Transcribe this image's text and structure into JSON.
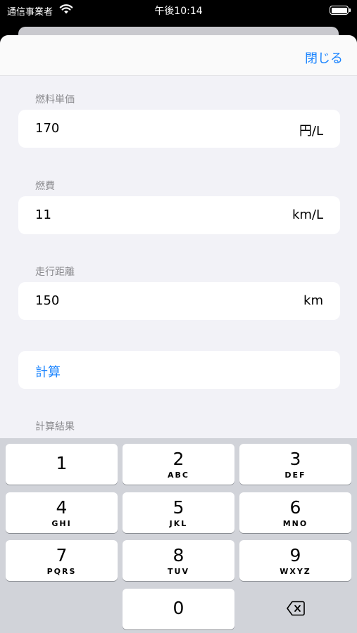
{
  "status_bar": {
    "carrier": "通信事業者",
    "time": "午後10:14"
  },
  "header": {
    "close_label": "閉じる"
  },
  "fields": [
    {
      "label": "燃料単価",
      "value": "170",
      "unit": "円/L"
    },
    {
      "label": "燃費",
      "value": "11",
      "unit": "km/L"
    },
    {
      "label": "走行距離",
      "value": "150",
      "unit": "km"
    }
  ],
  "calc_button": {
    "label": "計算"
  },
  "result": {
    "label": "計算結果"
  },
  "keypad": {
    "keys": [
      {
        "num": "1",
        "letters": ""
      },
      {
        "num": "2",
        "letters": "ABC"
      },
      {
        "num": "3",
        "letters": "DEF"
      },
      {
        "num": "4",
        "letters": "GHI"
      },
      {
        "num": "5",
        "letters": "JKL"
      },
      {
        "num": "6",
        "letters": "MNO"
      },
      {
        "num": "7",
        "letters": "PQRS"
      },
      {
        "num": "8",
        "letters": "TUV"
      },
      {
        "num": "9",
        "letters": "WXYZ"
      },
      {
        "num": "0",
        "letters": ""
      }
    ],
    "delete_icon": "backspace-icon"
  },
  "colors": {
    "accent": "#1a84ff",
    "sheet_bg": "#f2f2f7",
    "keyboard_bg": "#d1d3d9"
  }
}
